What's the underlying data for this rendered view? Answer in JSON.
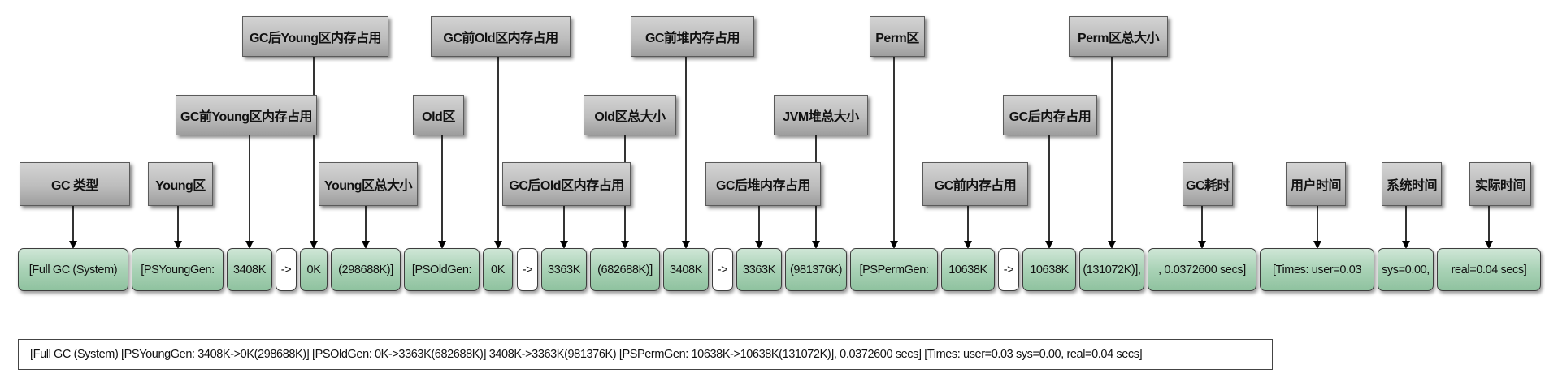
{
  "labels": [
    {
      "id": "gc-type",
      "text": "GC 类型"
    },
    {
      "id": "young-area",
      "text": "Young区"
    },
    {
      "id": "young-before",
      "text": "GC前Young区内存占用"
    },
    {
      "id": "young-after",
      "text": "GC后Young区内存占用"
    },
    {
      "id": "young-total",
      "text": "Young区总大小"
    },
    {
      "id": "old-area",
      "text": "Old区"
    },
    {
      "id": "old-before",
      "text": "GC前Old区内存占用"
    },
    {
      "id": "old-after",
      "text": "GC后Old区内存占用"
    },
    {
      "id": "old-total",
      "text": "Old区总大小"
    },
    {
      "id": "heap-before",
      "text": "GC前堆内存占用"
    },
    {
      "id": "heap-after",
      "text": "GC后堆内存占用"
    },
    {
      "id": "heap-total",
      "text": "JVM堆总大小"
    },
    {
      "id": "perm-area",
      "text": "Perm区"
    },
    {
      "id": "perm-before",
      "text": "GC前内存占用"
    },
    {
      "id": "perm-after",
      "text": "GC后内存占用"
    },
    {
      "id": "perm-total",
      "text": "Perm区总大小"
    },
    {
      "id": "gc-time",
      "text": "GC耗时"
    },
    {
      "id": "user-time",
      "text": "用户时间"
    },
    {
      "id": "sys-time",
      "text": "系统时间"
    },
    {
      "id": "real-time",
      "text": "实际时间"
    }
  ],
  "segments": [
    "[Full GC (System)",
    "[PSYoungGen:",
    "3408K",
    "->",
    "0K",
    "(298688K)]",
    "[PSOldGen:",
    "0K",
    "->",
    "3363K",
    "(682688K)]",
    "3408K",
    "->",
    "3363K",
    "(981376K)",
    "[PSPermGen:",
    "10638K",
    "->",
    "10638K",
    "(131072K)],",
    ", 0.0372600 secs]",
    "[Times: user=0.03",
    "sys=0.00,",
    "real=0.04 secs]"
  ],
  "full_log": "[Full GC (System) [PSYoungGen: 3408K->0K(298688K)] [PSOldGen: 0K->3363K(682688K)] 3408K->3363K(981376K) [PSPermGen: 10638K->10638K(131072K)], 0.0372600 secs] [Times: user=0.03 sys=0.00, real=0.04 secs]",
  "colors": {
    "segment_fill": "#a9d2b6",
    "label_fill": "#bdbdbd",
    "line": "#000000"
  }
}
